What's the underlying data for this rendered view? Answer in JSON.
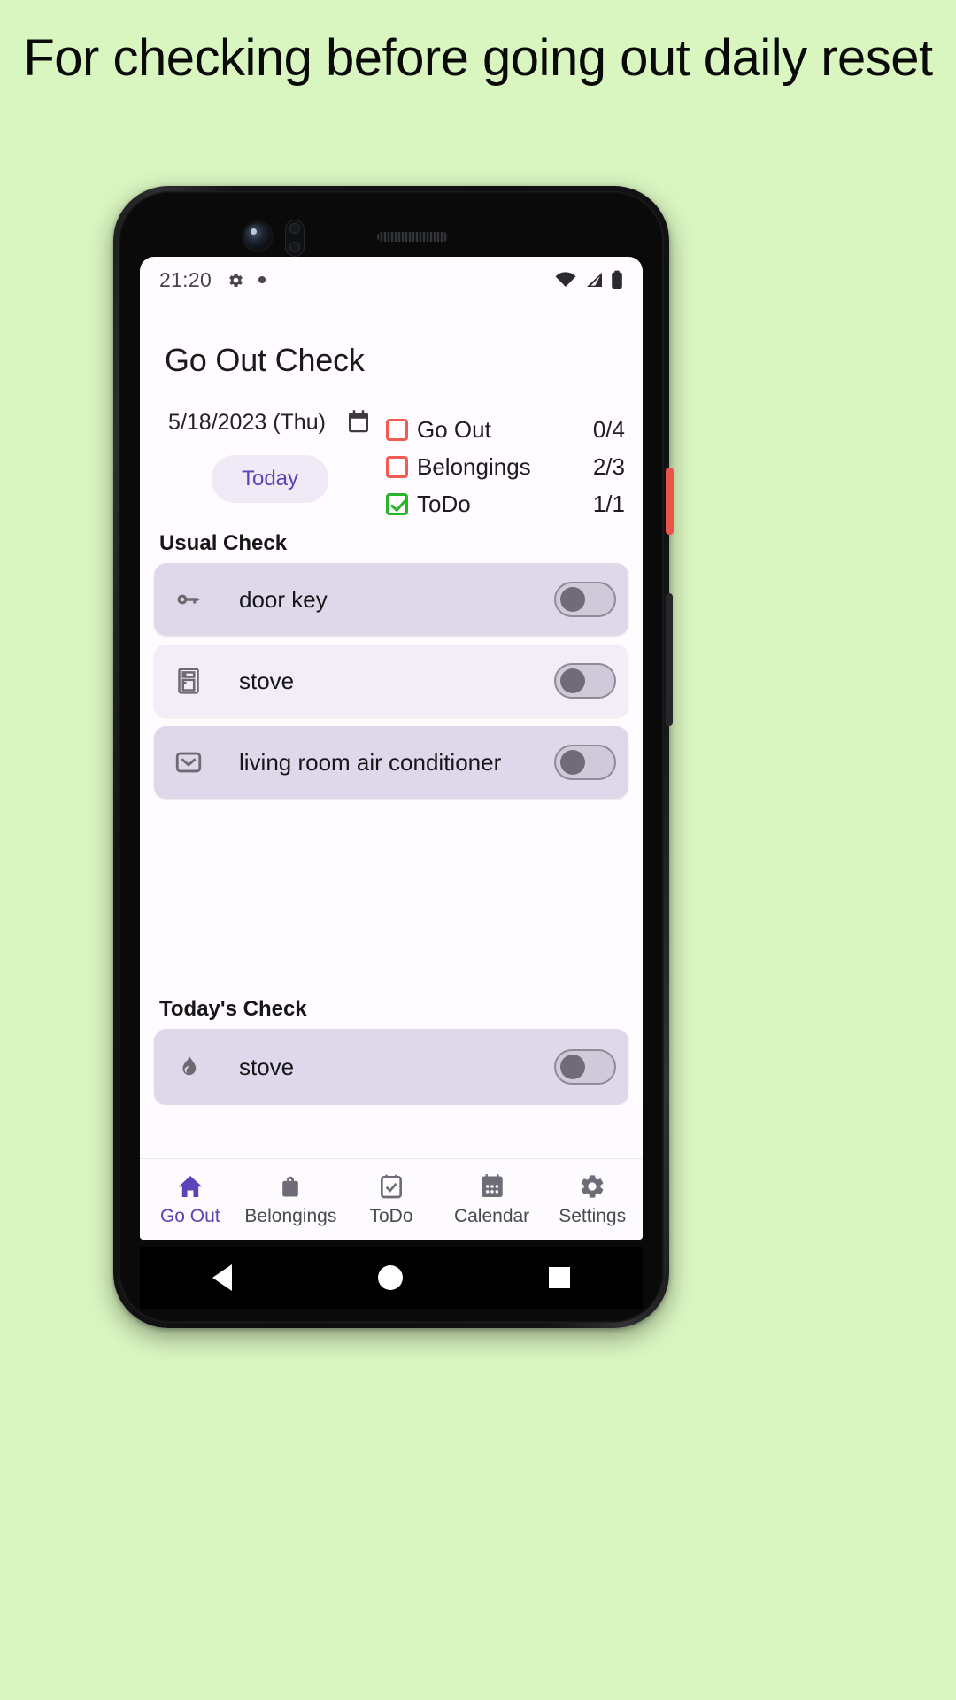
{
  "headline": "For checking before going out daily reset",
  "phone": {
    "status_bar": {
      "time": "21:20",
      "left_icons": [
        "gear-icon",
        "dot-icon"
      ],
      "right_icons": [
        "wifi-icon",
        "signal-icon",
        "battery-icon"
      ]
    },
    "app": {
      "title": "Go Out Check",
      "date": {
        "text": "5/18/2023 (Thu)",
        "calendar_icon": "calendar-icon",
        "today_button": "Today"
      },
      "summary": [
        {
          "label": "Go Out",
          "count": "0/4",
          "checked": false
        },
        {
          "label": "Belongings",
          "count": "2/3",
          "checked": false
        },
        {
          "label": "ToDo",
          "count": "1/1",
          "checked": true
        }
      ],
      "usual_check": {
        "heading": "Usual Check",
        "items": [
          {
            "label": "door key",
            "icon": "key-icon",
            "on": false
          },
          {
            "label": "stove",
            "icon": "stove-icon",
            "on": false
          },
          {
            "label": "living room air conditioner",
            "icon": "air-conditioner-icon",
            "on": false
          }
        ]
      },
      "todays_check": {
        "heading": "Today's Check",
        "items": [
          {
            "label": "stove",
            "icon": "flame-icon",
            "on": false
          }
        ]
      },
      "bottom_nav": [
        {
          "label": "Go Out",
          "icon": "home-icon",
          "active": true
        },
        {
          "label": "Belongings",
          "icon": "bag-icon",
          "active": false
        },
        {
          "label": "ToDo",
          "icon": "task-check-icon",
          "active": false
        },
        {
          "label": "Calendar",
          "icon": "calendar-grid-icon",
          "active": false
        },
        {
          "label": "Settings",
          "icon": "gear-icon",
          "active": false
        }
      ]
    },
    "system_nav": [
      "back-button",
      "home-button",
      "recents-button"
    ]
  },
  "colors": {
    "background": "#d9f5c0",
    "accent": "#5b43b8",
    "unchecked": "#f25a52",
    "checked": "#2ab42a",
    "row": "#ded8ea",
    "row_alt": "#f2edf7"
  }
}
